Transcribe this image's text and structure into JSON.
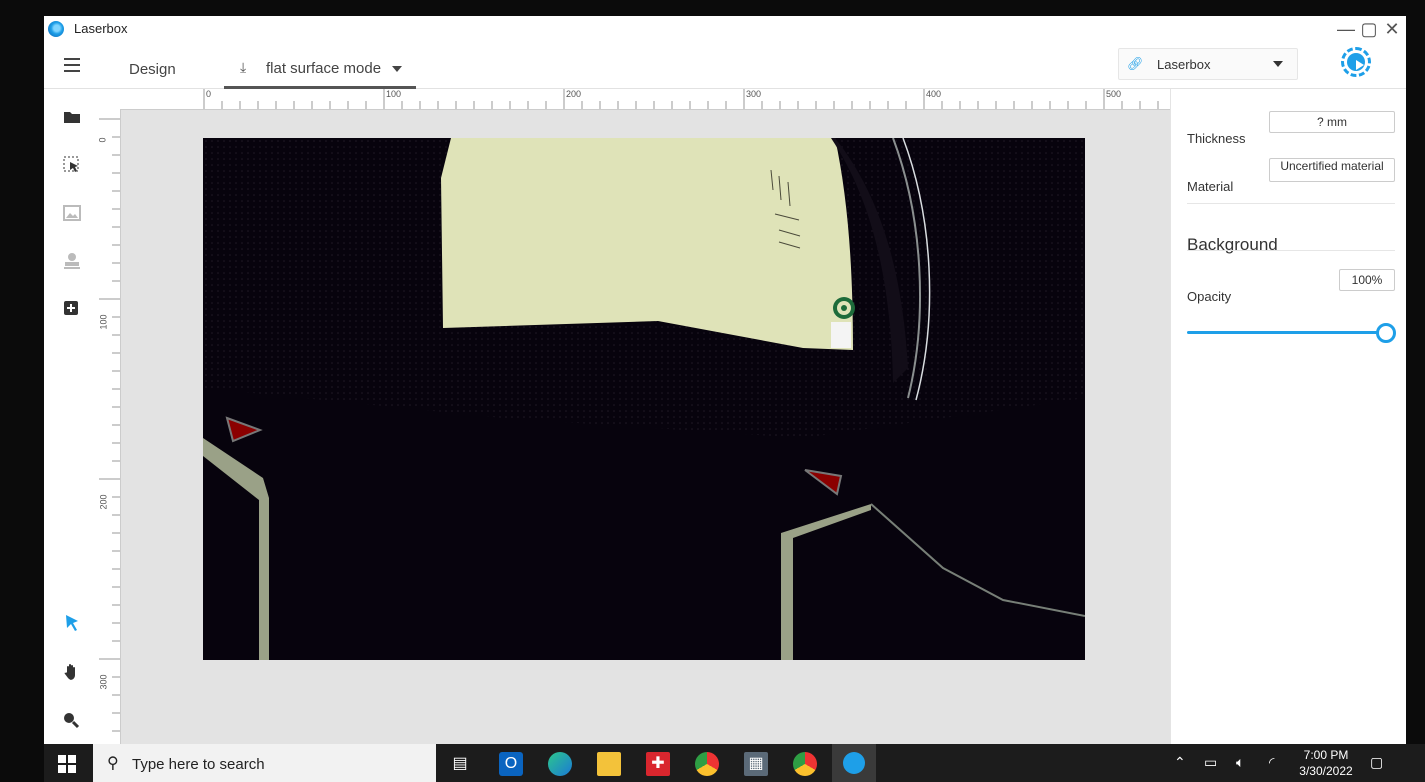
{
  "window": {
    "title": "Laserbox"
  },
  "toolbar": {
    "design_tab": "Design",
    "mode_tab": "flat surface mode",
    "device_name": "Laserbox"
  },
  "ruler": {
    "top_ticks": [
      "0",
      "100",
      "200",
      "300",
      "400",
      "500"
    ],
    "left_ticks": [
      "0",
      "100",
      "200",
      "300"
    ]
  },
  "right_panel": {
    "thickness_label": "Thickness",
    "thickness_value": "?  mm",
    "material_label": "Material",
    "material_value": "Uncertified material",
    "background_heading": "Background",
    "opacity_label": "Opacity",
    "opacity_value": "100%",
    "opacity_level": 1.0
  },
  "left_tools": [
    "folder-open-icon",
    "select-area-icon",
    "image-icon",
    "stamp-icon",
    "add-shape-icon",
    "pointer-icon",
    "hand-icon",
    "zoom-icon"
  ],
  "taskbar": {
    "search_placeholder": "Type here to search",
    "time": "7:00 PM",
    "date": "3/30/2022"
  },
  "colors": {
    "accent": "#1e9fe8",
    "photo_bg": "#07030d",
    "paper": "#dfe3b8"
  }
}
